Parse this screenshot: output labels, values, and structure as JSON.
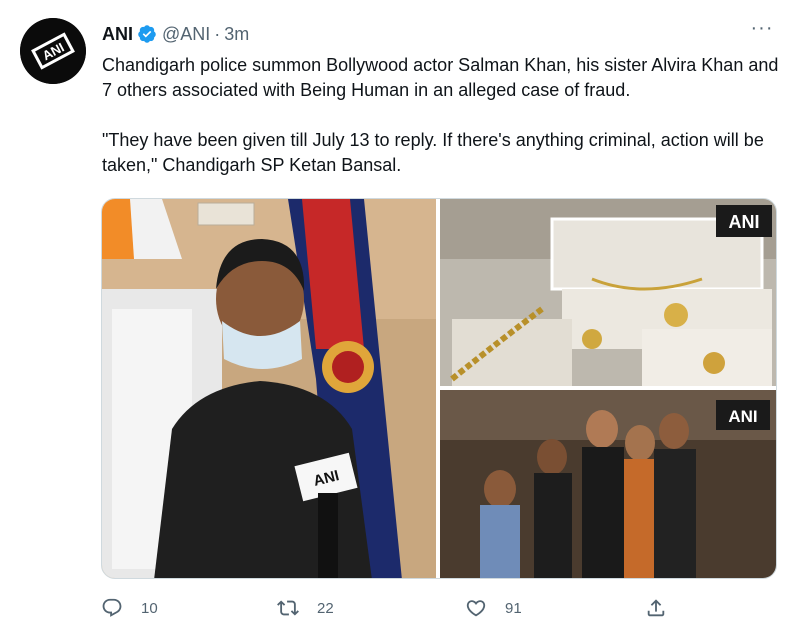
{
  "author": {
    "name": "ANI",
    "handle": "@ANI",
    "separator": "·",
    "time": "3m",
    "avatar_icon": "ani-logo",
    "avatar_logo_text": "ANI"
  },
  "menu": {
    "label": "···"
  },
  "tweet": {
    "paragraph1": "Chandigarh police summon Bollywood actor Salman Khan, his sister Alvira Khan and 7 others associated with Being Human in an alleged case of fraud.",
    "paragraph2": "\"They have been given till July 13 to reply. If there's anything criminal, action will be taken,\" Chandigarh SP Ketan Bansal."
  },
  "media": {
    "watermark": "ANI",
    "images": [
      {
        "name": "sp-interview-photo",
        "watermark": "ANI"
      },
      {
        "name": "jewellery-display-photo",
        "watermark": "ANI"
      },
      {
        "name": "group-photo",
        "watermark": "ANI"
      }
    ]
  },
  "actions": {
    "reply": {
      "icon": "reply-icon",
      "count": "10"
    },
    "retweet": {
      "icon": "retweet-icon",
      "count": "22"
    },
    "like": {
      "icon": "heart-icon",
      "count": "91"
    },
    "share": {
      "icon": "share-icon",
      "count": ""
    }
  },
  "colors": {
    "verified": "#1d9bf0",
    "secondary_text": "#536471",
    "primary_text": "#0f1419"
  }
}
